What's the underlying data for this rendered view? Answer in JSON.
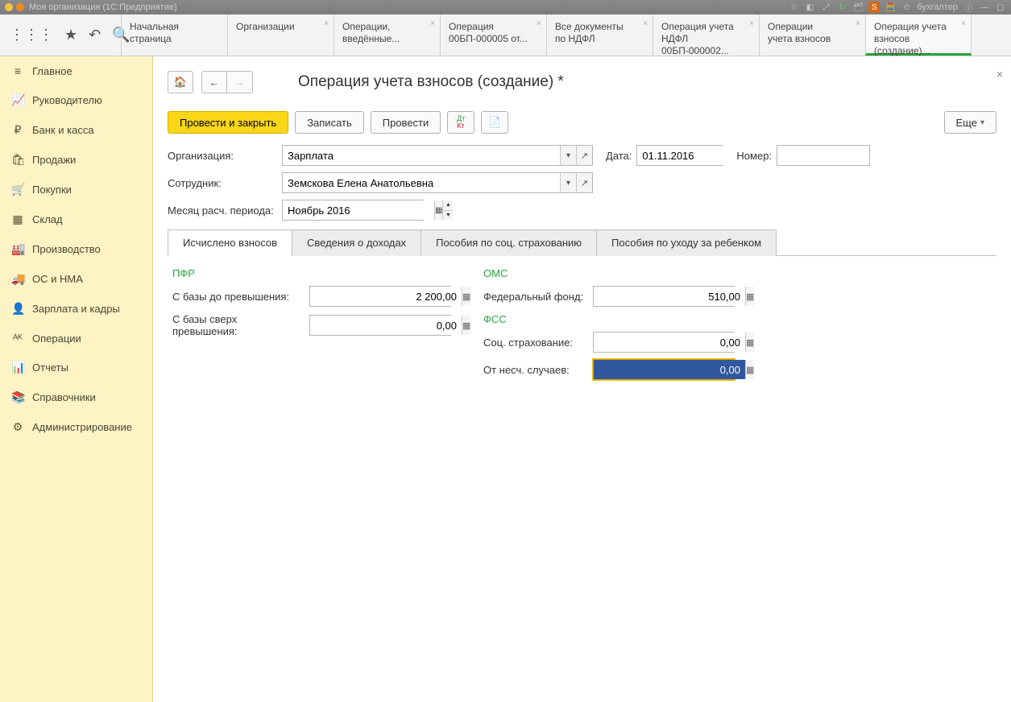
{
  "topbar": {
    "title": "Моя организация  (1С:Предприятие)",
    "user": "бухгалтер"
  },
  "topTabs": [
    {
      "line1": "Начальная",
      "line2": "страница",
      "closable": false
    },
    {
      "line1": "Организации",
      "line2": "",
      "closable": true
    },
    {
      "line1": "Операции,",
      "line2": "введённые...",
      "closable": true
    },
    {
      "line1": "Операция",
      "line2": "00БП-000005 от...",
      "closable": true
    },
    {
      "line1": "Все документы",
      "line2": "по НДФЛ",
      "closable": true
    },
    {
      "line1": "Операция учета",
      "line2": "НДФЛ 00БП-000002...",
      "closable": true
    },
    {
      "line1": "Операции",
      "line2": "учета взносов",
      "closable": true
    },
    {
      "line1": "Операция учета",
      "line2": "взносов (создание)...",
      "closable": true,
      "active": true
    }
  ],
  "sidebar": [
    {
      "label": "Главное",
      "icon": "≡"
    },
    {
      "label": "Руководителю",
      "icon": "📈"
    },
    {
      "label": "Банк и касса",
      "icon": "₽"
    },
    {
      "label": "Продажи",
      "icon": "🛍"
    },
    {
      "label": "Покупки",
      "icon": "🛒"
    },
    {
      "label": "Склад",
      "icon": "▦"
    },
    {
      "label": "Производство",
      "icon": "🏭"
    },
    {
      "label": "ОС и НМА",
      "icon": "🚚"
    },
    {
      "label": "Зарплата и кадры",
      "icon": "👤"
    },
    {
      "label": "Операции",
      "icon": "ᴬᴷ"
    },
    {
      "label": "Отчеты",
      "icon": "📊"
    },
    {
      "label": "Справочники",
      "icon": "📚"
    },
    {
      "label": "Администрирование",
      "icon": "⚙"
    }
  ],
  "page": {
    "title": "Операция учета взносов (создание) *"
  },
  "actions": {
    "postClose": "Провести и закрыть",
    "write": "Записать",
    "post": "Провести",
    "more": "Еще"
  },
  "form": {
    "orgLabel": "Организация:",
    "orgValue": "Зарплата",
    "dateLabel": "Дата:",
    "dateValue": "01.11.2016",
    "numberLabel": "Номер:",
    "numberValue": "",
    "employeeLabel": "Сотрудник:",
    "employeeValue": "Земскова Елена Анатольевна",
    "periodLabel": "Месяц расч. периода:",
    "periodValue": "Ноябрь 2016"
  },
  "ctabs": [
    "Исчислено взносов",
    "Сведения о доходах",
    "Пособия по соц. страхованию",
    "Пособия по уходу за ребенком"
  ],
  "groups": {
    "pfr": {
      "title": "ПФР",
      "baseBeforeLabel": "С базы до превышения:",
      "baseBeforeValue": "2 200,00",
      "baseOverLabel": "С базы сверх превышения:",
      "baseOverValue": "0,00"
    },
    "oms": {
      "title": "ОМС",
      "fedLabel": "Федеральный фонд:",
      "fedValue": "510,00"
    },
    "fss": {
      "title": "ФСС",
      "socLabel": "Соц. страхование:",
      "socValue": "0,00",
      "accLabel": "От несч. случаев:",
      "accValue": "0,00"
    }
  }
}
